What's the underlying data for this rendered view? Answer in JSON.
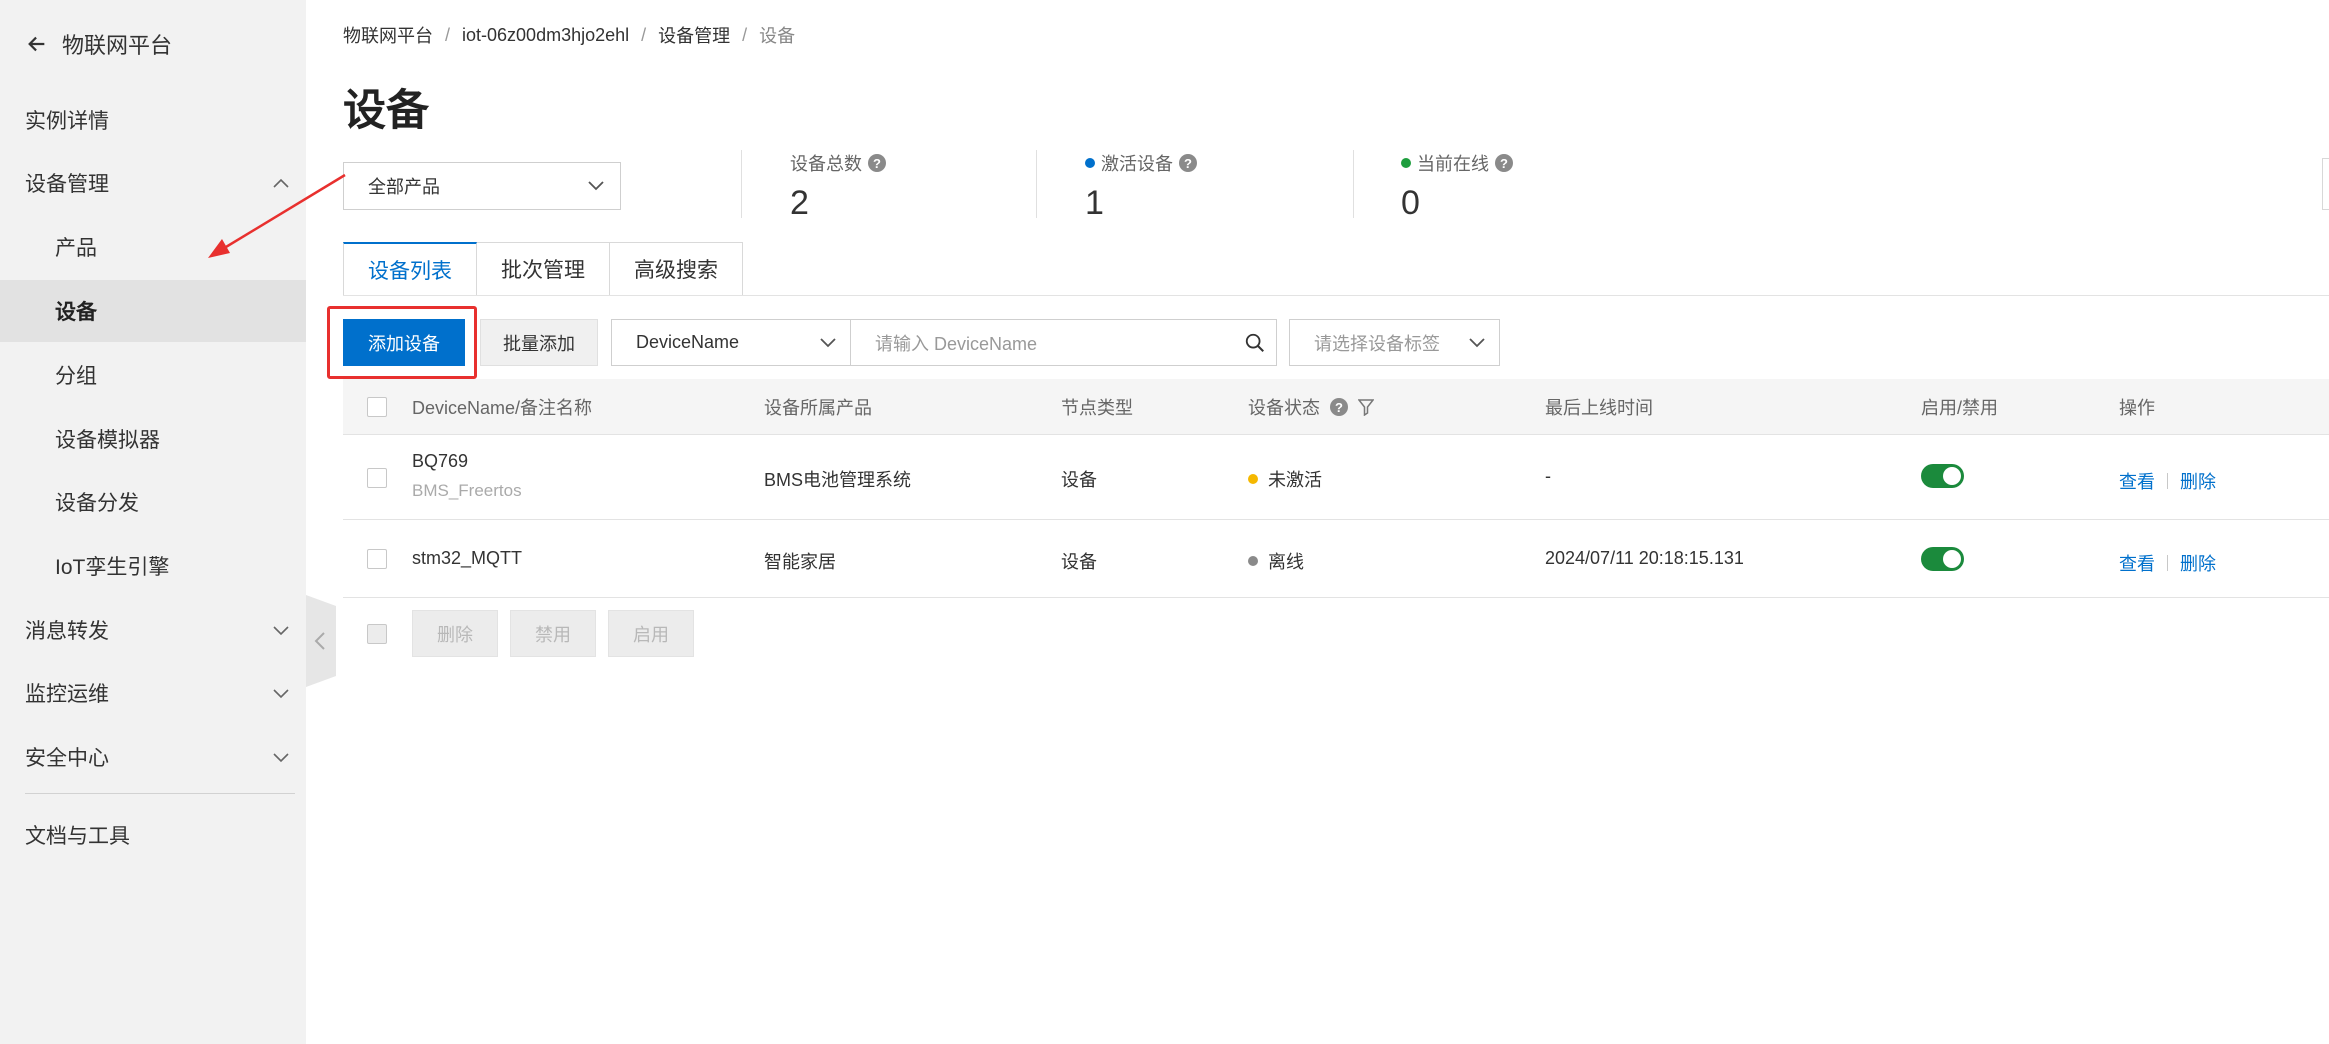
{
  "sidebar": {
    "back_label": "物联网平台",
    "items": [
      {
        "label": "实例详情"
      },
      {
        "label": "设备管理"
      },
      {
        "label": "产品"
      },
      {
        "label": "设备"
      },
      {
        "label": "分组"
      },
      {
        "label": "设备模拟器"
      },
      {
        "label": "设备分发"
      },
      {
        "label": "IoT孪生引擎"
      },
      {
        "label": "消息转发"
      },
      {
        "label": "监控运维"
      },
      {
        "label": "安全中心"
      },
      {
        "label": "文档与工具"
      }
    ]
  },
  "breadcrumb": [
    "物联网平台",
    "iot-06z00dm3hjo2ehl",
    "设备管理",
    "设备"
  ],
  "page_title": "设备",
  "product_filter": {
    "value": "全部产品"
  },
  "stats": [
    {
      "label": "设备总数",
      "value": "2"
    },
    {
      "label": "激活设备",
      "value": "1",
      "dot_color": "#0070cc"
    },
    {
      "label": "当前在线",
      "value": "0",
      "dot_color": "#1e9e3e"
    }
  ],
  "tabs": [
    "设备列表",
    "批次管理",
    "高级搜索"
  ],
  "toolbar": {
    "add_label": "添加设备",
    "batch_add_label": "批量添加",
    "search_type": "DeviceName",
    "search_placeholder": "请输入 DeviceName",
    "tag_placeholder": "请选择设备标签"
  },
  "table": {
    "columns": [
      "DeviceName/备注名称",
      "设备所属产品",
      "节点类型",
      "设备状态",
      "最后上线时间",
      "启用/禁用",
      "操作"
    ],
    "rows": [
      {
        "name": "BQ769",
        "remark": "BMS_Freertos",
        "product": "BMS电池管理系统",
        "node_type": "设备",
        "status": "未激活",
        "status_color": "#f5b800",
        "last_online": "-",
        "view": "查看",
        "delete": "删除"
      },
      {
        "name": "stm32_MQTT",
        "remark": "",
        "product": "智能家居",
        "node_type": "设备",
        "status": "离线",
        "status_color": "#8a8a8a",
        "last_online": "2024/07/11 20:18:15.131",
        "view": "查看",
        "delete": "删除"
      }
    ]
  },
  "bulk_actions": [
    "删除",
    "禁用",
    "启用"
  ],
  "colors": {
    "primary": "#0070cc",
    "annotation": "#e8302e",
    "enabled_toggle": "#1b8a3c"
  }
}
